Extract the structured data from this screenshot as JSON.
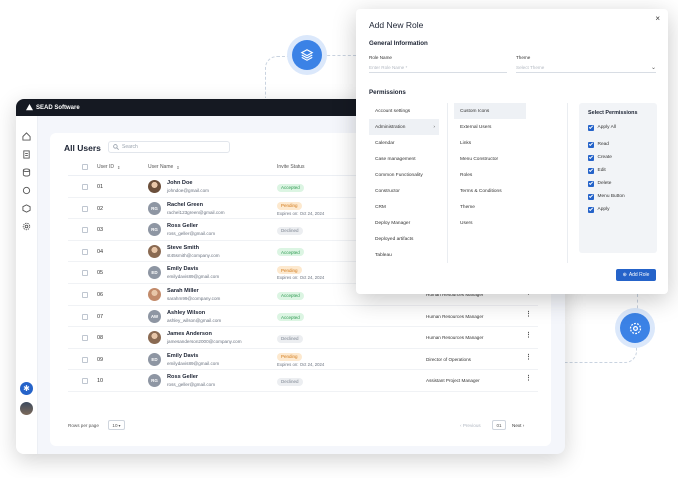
{
  "brand": {
    "name": "SEAD Software"
  },
  "sidebar": {
    "icons": [
      "home-icon",
      "document-icon",
      "database-icon",
      "puzzle-icon",
      "cube-icon",
      "settings-icon"
    ],
    "bottom": [
      "snowflake-icon",
      "user-avatar"
    ]
  },
  "users": {
    "title": "All Users",
    "search_placeholder": "Search",
    "columns": [
      "User ID",
      "User Name",
      "Invite Status"
    ],
    "rows": [
      {
        "id": "01",
        "name": "John Doe",
        "email": "johndoe@gmail.com",
        "status": "Accepted",
        "expires": "",
        "role": "",
        "initials": "",
        "photo": true
      },
      {
        "id": "02",
        "name": "Rachel Green",
        "email": "rachel123green@gmail.com",
        "status": "Pending",
        "expires": "Expires on: Oct 24, 2024",
        "role": "",
        "initials": "RG",
        "photo": false
      },
      {
        "id": "03",
        "name": "Ross Geller",
        "email": "ross_geller@gmail.com",
        "status": "Declined",
        "expires": "",
        "role": "",
        "initials": "RG",
        "photo": false
      },
      {
        "id": "04",
        "name": "Steve Smith",
        "email": "st45smith@company.com",
        "status": "Accepted",
        "expires": "",
        "role": "",
        "initials": "",
        "photo": true
      },
      {
        "id": "05",
        "name": "Emily Davis",
        "email": "emilydavis89@gmail.com",
        "status": "Pending",
        "expires": "Expires on: Oct 24, 2024",
        "role": "",
        "initials": "ED",
        "photo": false
      },
      {
        "id": "06",
        "name": "Sarah Miller",
        "email": "sarahm99@company.com",
        "status": "Accepted",
        "expires": "",
        "role": "Human Resources Manager",
        "initials": "",
        "photo": true
      },
      {
        "id": "07",
        "name": "Ashley Wilson",
        "email": "ashley_wilson@gmail.com",
        "status": "Accepted",
        "expires": "",
        "role": "Human Resources Manager",
        "initials": "AW",
        "photo": false
      },
      {
        "id": "08",
        "name": "James Anderson",
        "email": "jamesanderson2000@company.com",
        "status": "Declined",
        "expires": "",
        "role": "Human Resources Manager",
        "initials": "",
        "photo": true
      },
      {
        "id": "09",
        "name": "Emily Davis",
        "email": "emilydavis89@gmail.com",
        "status": "Pending",
        "expires": "Expires on: Oct 24, 2024",
        "role": "Director of Operations",
        "initials": "ED",
        "photo": false
      },
      {
        "id": "10",
        "name": "Ross Geller",
        "email": "ross_geller@gmail.com",
        "status": "Declined",
        "expires": "",
        "role": "Assistant Project Manager",
        "initials": "RG",
        "photo": false
      }
    ],
    "footer": {
      "rows_per_page_label": "Rows per page",
      "rows_per_page": "10",
      "prev": "Previous",
      "page": "01",
      "next": "Next"
    }
  },
  "modal": {
    "title": "Add New Role",
    "close": "×",
    "general_info": "General Information",
    "role_name_label": "Role Name",
    "role_name_placeholder": "Enter Role Name *",
    "theme_label": "Theme",
    "theme_placeholder": "Select Theme",
    "permissions_title": "Permissions",
    "col1": [
      "Account settings",
      "Administration",
      "Calendar",
      "Case management",
      "Common Functionality",
      "Constructor",
      "CRM",
      "Deploy Manager",
      "Deployed artifacts",
      "Tableau"
    ],
    "col2": [
      "Custom Icons",
      "External Users",
      "Links",
      "Menu Constructor",
      "Roles",
      "Terms & Conditions",
      "Theme",
      "Users"
    ],
    "select_permissions": "Select Permissions",
    "perms": [
      "Apply All",
      "Read",
      "Create",
      "Edit",
      "Delete",
      "Menu Button",
      "Apply"
    ],
    "add_button": "Add Role"
  },
  "colors": {
    "accent": "#2563c9",
    "float": "#3b82e6"
  }
}
